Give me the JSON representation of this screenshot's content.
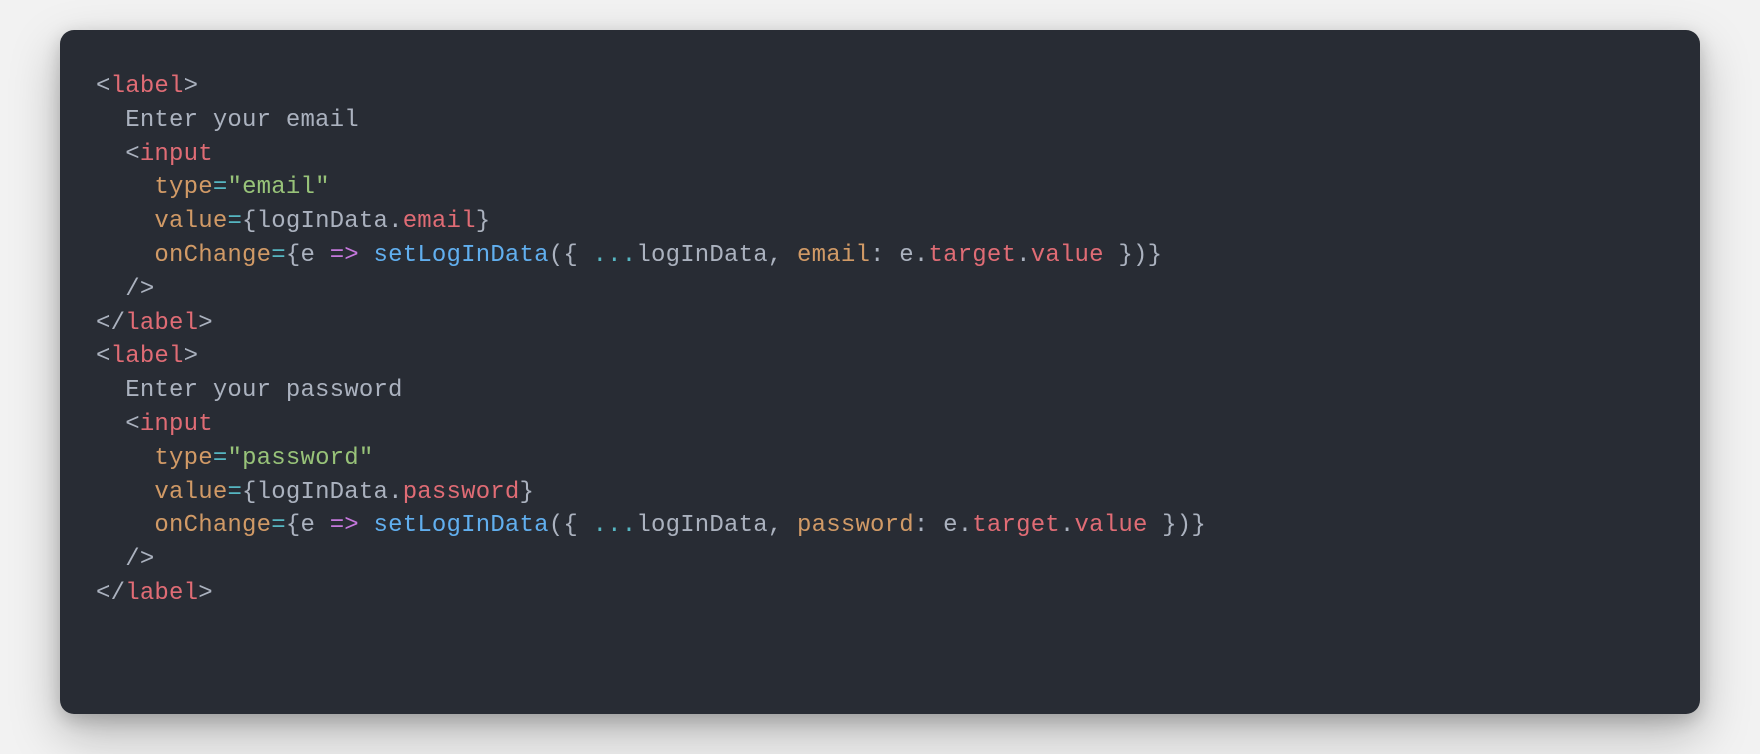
{
  "code": {
    "line1": {
      "p1": "<",
      "tag": "label",
      "p2": ">"
    },
    "line2": {
      "indent": "  ",
      "text": "Enter your email"
    },
    "line3": {
      "indent": "  ",
      "p1": "<",
      "tag": "input"
    },
    "line4": {
      "indent": "    ",
      "attr": "type",
      "eq": "=",
      "q1": "\"",
      "val": "email",
      "q2": "\""
    },
    "line5": {
      "indent": "    ",
      "attr": "value",
      "eq": "=",
      "b1": "{",
      "obj": "logInData",
      "dot": ".",
      "prop": "email",
      "b2": "}"
    },
    "line6": {
      "indent": "    ",
      "attr": "onChange",
      "eq": "=",
      "b1": "{",
      "param": "e",
      "sp1": " ",
      "arrow": "=>",
      "sp2": " ",
      "fn": "setLogInData",
      "p1": "(",
      "cb1": "{ ",
      "spread": "...",
      "obj": "logInData",
      "comma": ", ",
      "key": "email",
      "colon": ": ",
      "e": "e",
      "dot1": ".",
      "tgt": "target",
      "dot2": ".",
      "val": "value",
      "cb2": " }",
      "p2": ")",
      "b2": "}"
    },
    "line7": {
      "indent": "  ",
      "selfclose": "/>"
    },
    "line8": {
      "p1": "</",
      "tag": "label",
      "p2": ">"
    },
    "line9": {
      "p1": "<",
      "tag": "label",
      "p2": ">"
    },
    "line10": {
      "indent": "  ",
      "text": "Enter your password"
    },
    "line11": {
      "indent": "  ",
      "p1": "<",
      "tag": "input"
    },
    "line12": {
      "indent": "    ",
      "attr": "type",
      "eq": "=",
      "q1": "\"",
      "val": "password",
      "q2": "\""
    },
    "line13": {
      "indent": "    ",
      "attr": "value",
      "eq": "=",
      "b1": "{",
      "obj": "logInData",
      "dot": ".",
      "prop": "password",
      "b2": "}"
    },
    "line14": {
      "indent": "    ",
      "attr": "onChange",
      "eq": "=",
      "b1": "{",
      "param": "e",
      "sp1": " ",
      "arrow": "=>",
      "sp2": " ",
      "fn": "setLogInData",
      "p1": "(",
      "cb1": "{ ",
      "spread": "...",
      "obj": "logInData",
      "comma": ", ",
      "key": "password",
      "colon": ": ",
      "e": "e",
      "dot1": ".",
      "tgt": "target",
      "dot2": ".",
      "val": "value",
      "cb2": " }",
      "p2": ")",
      "b2": "}"
    },
    "line15": {
      "indent": "  ",
      "selfclose": "/>"
    },
    "line16": {
      "p1": "</",
      "tag": "label",
      "p2": ">"
    }
  }
}
